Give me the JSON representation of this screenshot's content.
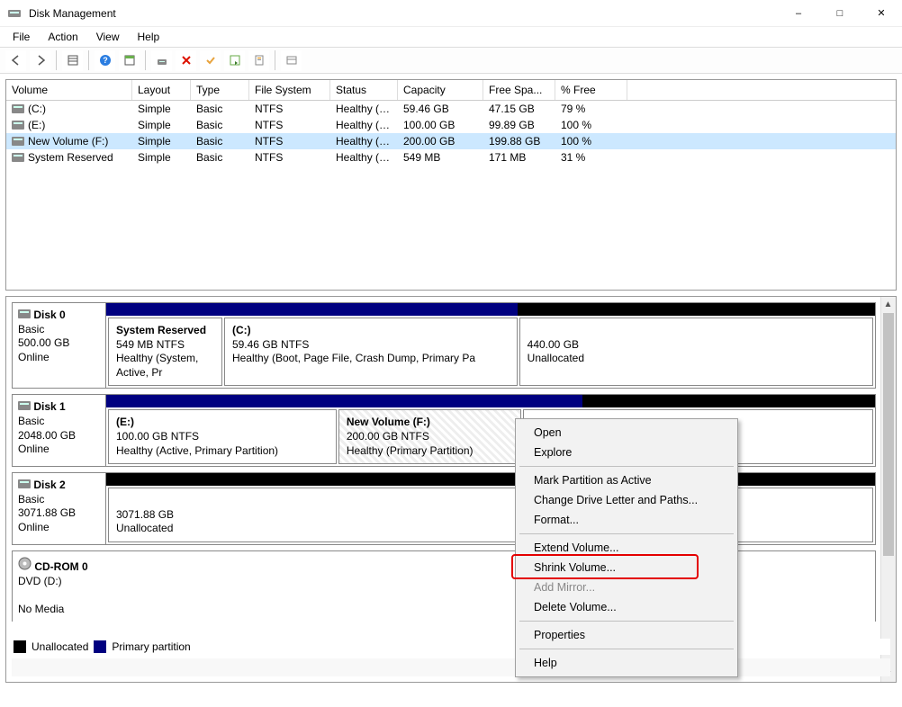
{
  "window": {
    "title": "Disk Management"
  },
  "menubar": [
    "File",
    "Action",
    "View",
    "Help"
  ],
  "context_menu": {
    "groups": [
      [
        "Open",
        "Explore"
      ],
      [
        "Mark Partition as Active",
        "Change Drive Letter and Paths...",
        "Format..."
      ],
      [
        "Extend Volume...",
        "Shrink Volume...",
        "Add Mirror...",
        "Delete Volume..."
      ],
      [
        "Properties"
      ],
      [
        "Help"
      ]
    ],
    "highlighted": "Shrink Volume..."
  },
  "columns": [
    "Volume",
    "Layout",
    "Type",
    "File System",
    "Status",
    "Capacity",
    "Free Spa...",
    "% Free"
  ],
  "volumes": [
    {
      "name": "(C:)",
      "layout": "Simple",
      "type": "Basic",
      "fs": "NTFS",
      "status": "Healthy (B...",
      "capacity": "59.46 GB",
      "free": "47.15 GB",
      "pct": "79 %"
    },
    {
      "name": "(E:)",
      "layout": "Simple",
      "type": "Basic",
      "fs": "NTFS",
      "status": "Healthy (A...",
      "capacity": "100.00 GB",
      "free": "99.89 GB",
      "pct": "100 %"
    },
    {
      "name": "New Volume (F:)",
      "layout": "Simple",
      "type": "Basic",
      "fs": "NTFS",
      "status": "Healthy (P...",
      "capacity": "200.00 GB",
      "free": "199.88 GB",
      "pct": "100 %",
      "selected": true
    },
    {
      "name": "System Reserved",
      "layout": "Simple",
      "type": "Basic",
      "fs": "NTFS",
      "status": "Healthy (S...",
      "capacity": "549 MB",
      "free": "171 MB",
      "pct": "31 %"
    }
  ],
  "disks": {
    "d0": {
      "label": "Disk 0",
      "btype": "Basic",
      "size": "500.00 GB",
      "state": "Online",
      "parts": [
        {
          "title": "System Reserved",
          "line2": "549 MB NTFS",
          "line3": "Healthy (System, Active, Pr"
        },
        {
          "title": "(C:)",
          "line2": "59.46 GB NTFS",
          "line3": "Healthy (Boot, Page File, Crash Dump, Primary Pa"
        },
        {
          "title": "",
          "line2": "440.00 GB",
          "line3": "Unallocated"
        }
      ]
    },
    "d1": {
      "label": "Disk 1",
      "btype": "Basic",
      "size": "2048.00 GB",
      "state": "Online",
      "parts": [
        {
          "title": "(E:)",
          "line2": "100.00 GB NTFS",
          "line3": "Healthy (Active, Primary Partition)"
        },
        {
          "title": "New Volume  (F:)",
          "line2": "200.00 GB NTFS",
          "line3": "Healthy (Primary Partition)",
          "selected": true
        }
      ]
    },
    "d2": {
      "label": "Disk 2",
      "btype": "Basic",
      "size": "3071.88 GB",
      "state": "Online",
      "parts": [
        {
          "title": "",
          "line2": "3071.88 GB",
          "line3": "Unallocated"
        }
      ]
    },
    "cd": {
      "label": "CD-ROM 0",
      "btype": "DVD (D:)",
      "size": "",
      "state": "No Media"
    }
  },
  "legend": {
    "unalloc": "Unallocated",
    "primary": "Primary partition"
  }
}
